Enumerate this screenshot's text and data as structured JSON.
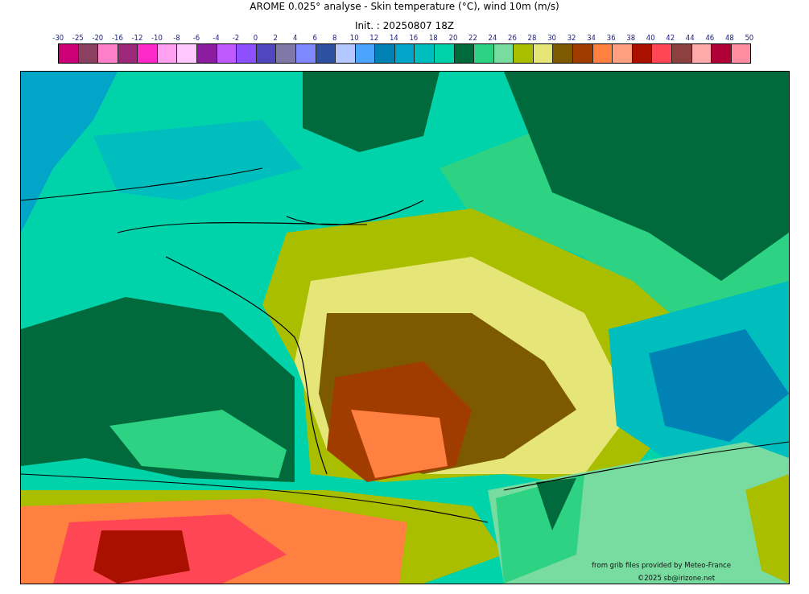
{
  "title": "AROME 0.025° analyse - Skin temperature (°C), wind 10m (m/s)",
  "subtitle": "Init. : 20250807 18Z",
  "colorbar": {
    "ticks": [
      "-30",
      "-25",
      "-20",
      "-16",
      "-12",
      "-10",
      "-8",
      "-6",
      "-4",
      "-2",
      "0",
      "2",
      "4",
      "6",
      "8",
      "10",
      "12",
      "14",
      "16",
      "18",
      "20",
      "22",
      "24",
      "26",
      "28",
      "30",
      "32",
      "34",
      "36",
      "38",
      "40",
      "42",
      "44",
      "46",
      "48",
      "50"
    ],
    "swatches": [
      {
        "color": "#cc0077"
      },
      {
        "color": "#8b4060"
      },
      {
        "color": "#ff80c8"
      },
      {
        "color": "#9b2878"
      },
      {
        "color": "#ff28c8"
      },
      {
        "color": "#ffa0f0"
      },
      {
        "color": "#ffc8ff"
      },
      {
        "color": "#8c1ca0"
      },
      {
        "color": "#be5aff"
      },
      {
        "color": "#8c50ff"
      },
      {
        "color": "#5046be"
      },
      {
        "color": "#8078a6"
      },
      {
        "color": "#8088ff"
      },
      {
        "color": "#2d50a0"
      },
      {
        "color": "#b4c8ff"
      },
      {
        "color": "#4ba5ff"
      },
      {
        "color": "#0082b4"
      },
      {
        "color": "#00a5c8"
      },
      {
        "color": "#00bebe"
      },
      {
        "color": "#00d2aa"
      },
      {
        "color": "#006a3c"
      },
      {
        "color": "#2dd282"
      },
      {
        "color": "#78dca0"
      },
      {
        "color": "#aabe00"
      },
      {
        "color": "#e6e678"
      },
      {
        "color": "#7d5a00"
      },
      {
        "color": "#a03c00"
      },
      {
        "color": "#ff8040"
      },
      {
        "color": "#ffa080"
      },
      {
        "color": "#aa1000"
      },
      {
        "color": "#ff4655"
      },
      {
        "color": "#8c4040"
      },
      {
        "color": "#ffaaaa"
      },
      {
        "color": "#b00038"
      },
      {
        "color": "#ff8ca0"
      }
    ]
  },
  "map": {
    "credits": [
      "from grib files provided by Meteo-France",
      "©2025 sb@irizone.net"
    ]
  }
}
